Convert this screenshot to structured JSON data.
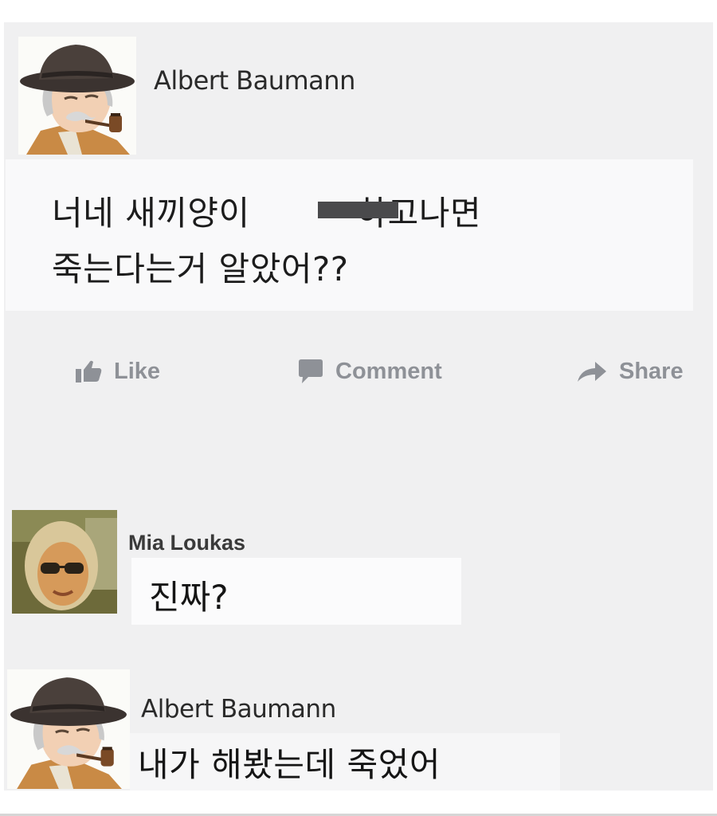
{
  "post": {
    "author": "Albert Baumann",
    "avatar_icon": "cartoon-old-man-hat-pipe-avatar",
    "line1_part1": "너네 새끼양이 ",
    "line1_part2": "하고나면",
    "line2": "죽는다는거 알았어??"
  },
  "actions": {
    "like": "Like",
    "comment": "Comment",
    "share": "Share"
  },
  "comments": [
    {
      "author": "Mia Loukas",
      "avatar_icon": "woman-sunglasses-photo-avatar",
      "text": "진짜?"
    },
    {
      "author": "Albert Baumann",
      "avatar_icon": "cartoon-old-man-hat-pipe-avatar",
      "text": "내가 해봤는데 죽었어"
    }
  ],
  "colors": {
    "panel_bg": "#f0f0f1",
    "action_gray": "#8e9197",
    "censor": "#4a4a4c"
  }
}
